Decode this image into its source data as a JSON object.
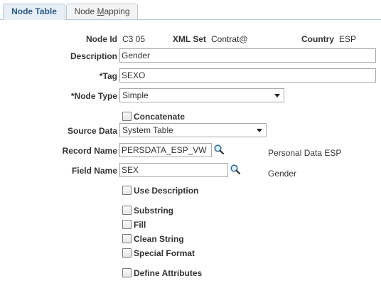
{
  "tabs": [
    {
      "label": "Node Table",
      "active": true
    },
    {
      "label_pre": "Node ",
      "label_accel": "M",
      "label_post": "apping",
      "active": false
    }
  ],
  "header": {
    "node_id_label": "Node Id",
    "node_id_value": "C3 05",
    "xml_set_label": "XML Set",
    "xml_set_value": "Contrat@",
    "country_label": "Country",
    "country_value": "ESP"
  },
  "form": {
    "description_label": "Description",
    "description_value": "Gender",
    "tag_label": "*Tag",
    "tag_value": "SEXO",
    "node_type_label": "*Node Type",
    "node_type_value": "Simple",
    "concatenate_label": "Concatenate",
    "source_data_label": "Source Data",
    "source_data_value": "System Table",
    "record_name_label": "Record Name",
    "record_name_value": "PERSDATA_ESP_VW",
    "record_name_desc": "Personal Data ESP",
    "field_name_label": "Field Name",
    "field_name_value": "SEX",
    "field_name_desc": "Gender",
    "use_description_label": "Use Description",
    "substring_label": "Substring",
    "fill_label": "Fill",
    "clean_string_label": "Clean String",
    "special_format_label": "Special Format",
    "define_attributes_label": "Define Attributes"
  },
  "icons": {
    "lookup": "magnifier-icon",
    "dropdown": "chevron-down-icon"
  },
  "colors": {
    "tab_active_bg": "#e7eef5",
    "tab_active_text": "#2a5b86",
    "tab_border": "#b8c9d6"
  }
}
